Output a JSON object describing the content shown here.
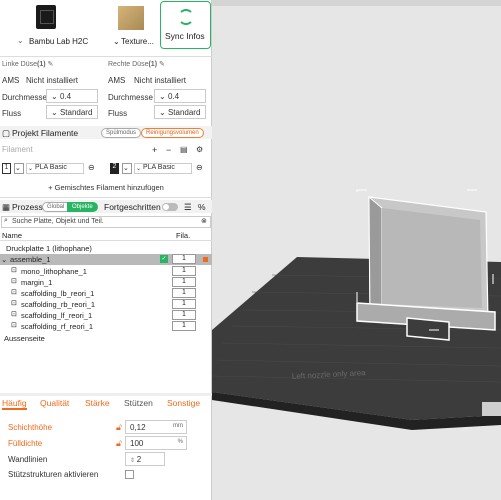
{
  "printer": {
    "name": "Bambu Lab H2C",
    "plate": "Texture..."
  },
  "sync": {
    "label": "Sync Infos"
  },
  "left_nozzle": {
    "header": "Linke Düse",
    "count": "(1)",
    "ams_label": "AMS",
    "ams_value": "Nicht installiert",
    "diameter_label": "Durchmesse",
    "diameter_value": "0.4",
    "flow_label": "Fluss",
    "flow_value": "Standard"
  },
  "right_nozzle": {
    "header": "Rechte Düse",
    "count": "(1)",
    "ams_label": "AMS",
    "ams_value": "Nicht installiert",
    "diameter_label": "Durchmesse",
    "diameter_value": "0.4",
    "flow_label": "Fluss",
    "flow_value": "Standard"
  },
  "filaments_section": {
    "title": "Projekt Filamente",
    "flush_mode": "Spülmodus",
    "cleaning_volume": "Reinigungsvolumen",
    "filament_label": "Filament",
    "add_label": "+ Gemischtes Filament hinzufügen",
    "items": [
      {
        "num": "1",
        "name": "PLA Basic"
      },
      {
        "num": "2",
        "name": "PLA Basic"
      }
    ]
  },
  "process_section": {
    "title": "Prozess",
    "global": "Global",
    "objects": "Objekte",
    "advanced": "Fortgeschritten"
  },
  "search": {
    "placeholder": "Suche Platte, Objekt und Teil."
  },
  "tree": {
    "col_name": "Name",
    "col_fila": "Fila.",
    "plate": "Druckplatte 1 (lithophane)",
    "assemble": "assemble_1",
    "assemble_fila": "1",
    "parts": [
      {
        "name": "mono_lithophane_1",
        "fila": "1"
      },
      {
        "name": "margin_1",
        "fila": "1"
      },
      {
        "name": "scaffolding_lb_reori_1",
        "fila": "1"
      },
      {
        "name": "scaffolding_rb_reori_1",
        "fila": "1"
      },
      {
        "name": "scaffolding_lf_reori_1",
        "fila": "1"
      },
      {
        "name": "scaffolding_rf_reori_1",
        "fila": "1"
      }
    ],
    "outer": "Aussenseite"
  },
  "settings_tabs": [
    "Häufig",
    "Qualität",
    "Stärke",
    "Stützen",
    "Sonstige"
  ],
  "settings": {
    "layer_height_label": "Schichthöhe",
    "layer_height_value": "0,12",
    "layer_height_unit": "mm",
    "infill_label": "Fülldichte",
    "infill_value": "100",
    "infill_unit": "%",
    "walls_label": "Wandlinien",
    "walls_value": "2",
    "support_label": "Stützstrukturen aktivieren"
  },
  "bed_text": "Left nozzle only area",
  "colors": {
    "accent_green": "#28b463",
    "accent_orange": "#f06a1c"
  }
}
